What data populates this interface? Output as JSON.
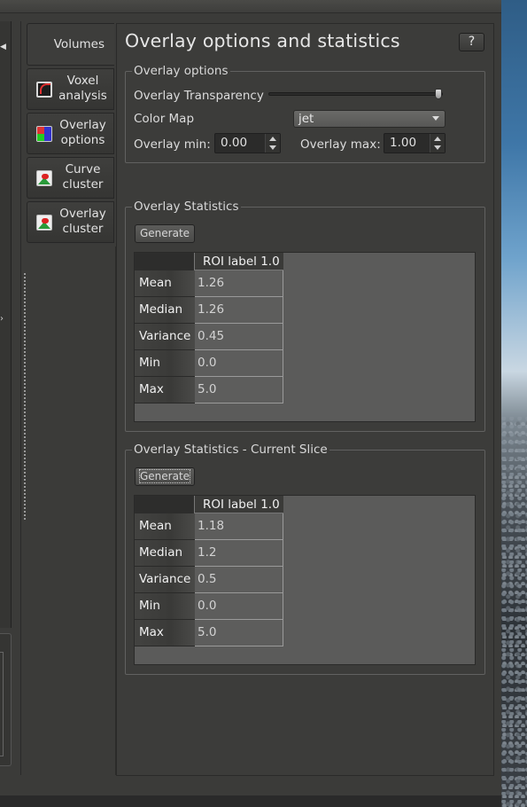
{
  "tabs": [
    {
      "label": "Volumes",
      "icon": "none"
    },
    {
      "label": "Voxel analysis",
      "icon": "voxel-analysis-icon"
    },
    {
      "label": "Overlay options",
      "icon": "color-grid-icon"
    },
    {
      "label": "Curve cluster",
      "icon": "image-icon"
    },
    {
      "label": "Overlay cluster",
      "icon": "image-icon"
    }
  ],
  "page": {
    "title": "Overlay options and statistics",
    "help_label": "?"
  },
  "overlay_options": {
    "legend": "Overlay options",
    "transparency_label": "Overlay Transparency",
    "transparency_value": 1.0,
    "colormap_label": "Color Map",
    "colormap_value": "jet",
    "min_label": "Overlay min:",
    "min_value": "0.00",
    "max_label": "Overlay max:",
    "max_value": "1.00"
  },
  "overlay_statistics": {
    "legend": "Overlay Statistics",
    "generate_label": "Generate",
    "column": "ROI label 1.0",
    "rows": [
      {
        "label": "Mean",
        "value": "1.26"
      },
      {
        "label": "Median",
        "value": "1.26"
      },
      {
        "label": "Variance",
        "value": "0.45"
      },
      {
        "label": "Min",
        "value": "0.0"
      },
      {
        "label": "Max",
        "value": "5.0"
      }
    ]
  },
  "current_slice_statistics": {
    "legend": "Overlay Statistics - Current Slice",
    "generate_label": "Generate",
    "column": "ROI label 1.0",
    "rows": [
      {
        "label": "Mean",
        "value": "1.18"
      },
      {
        "label": "Median",
        "value": "1.2"
      },
      {
        "label": "Variance",
        "value": "0.5"
      },
      {
        "label": "Min",
        "value": "0.0"
      },
      {
        "label": "Max",
        "value": "5.0"
      }
    ]
  }
}
